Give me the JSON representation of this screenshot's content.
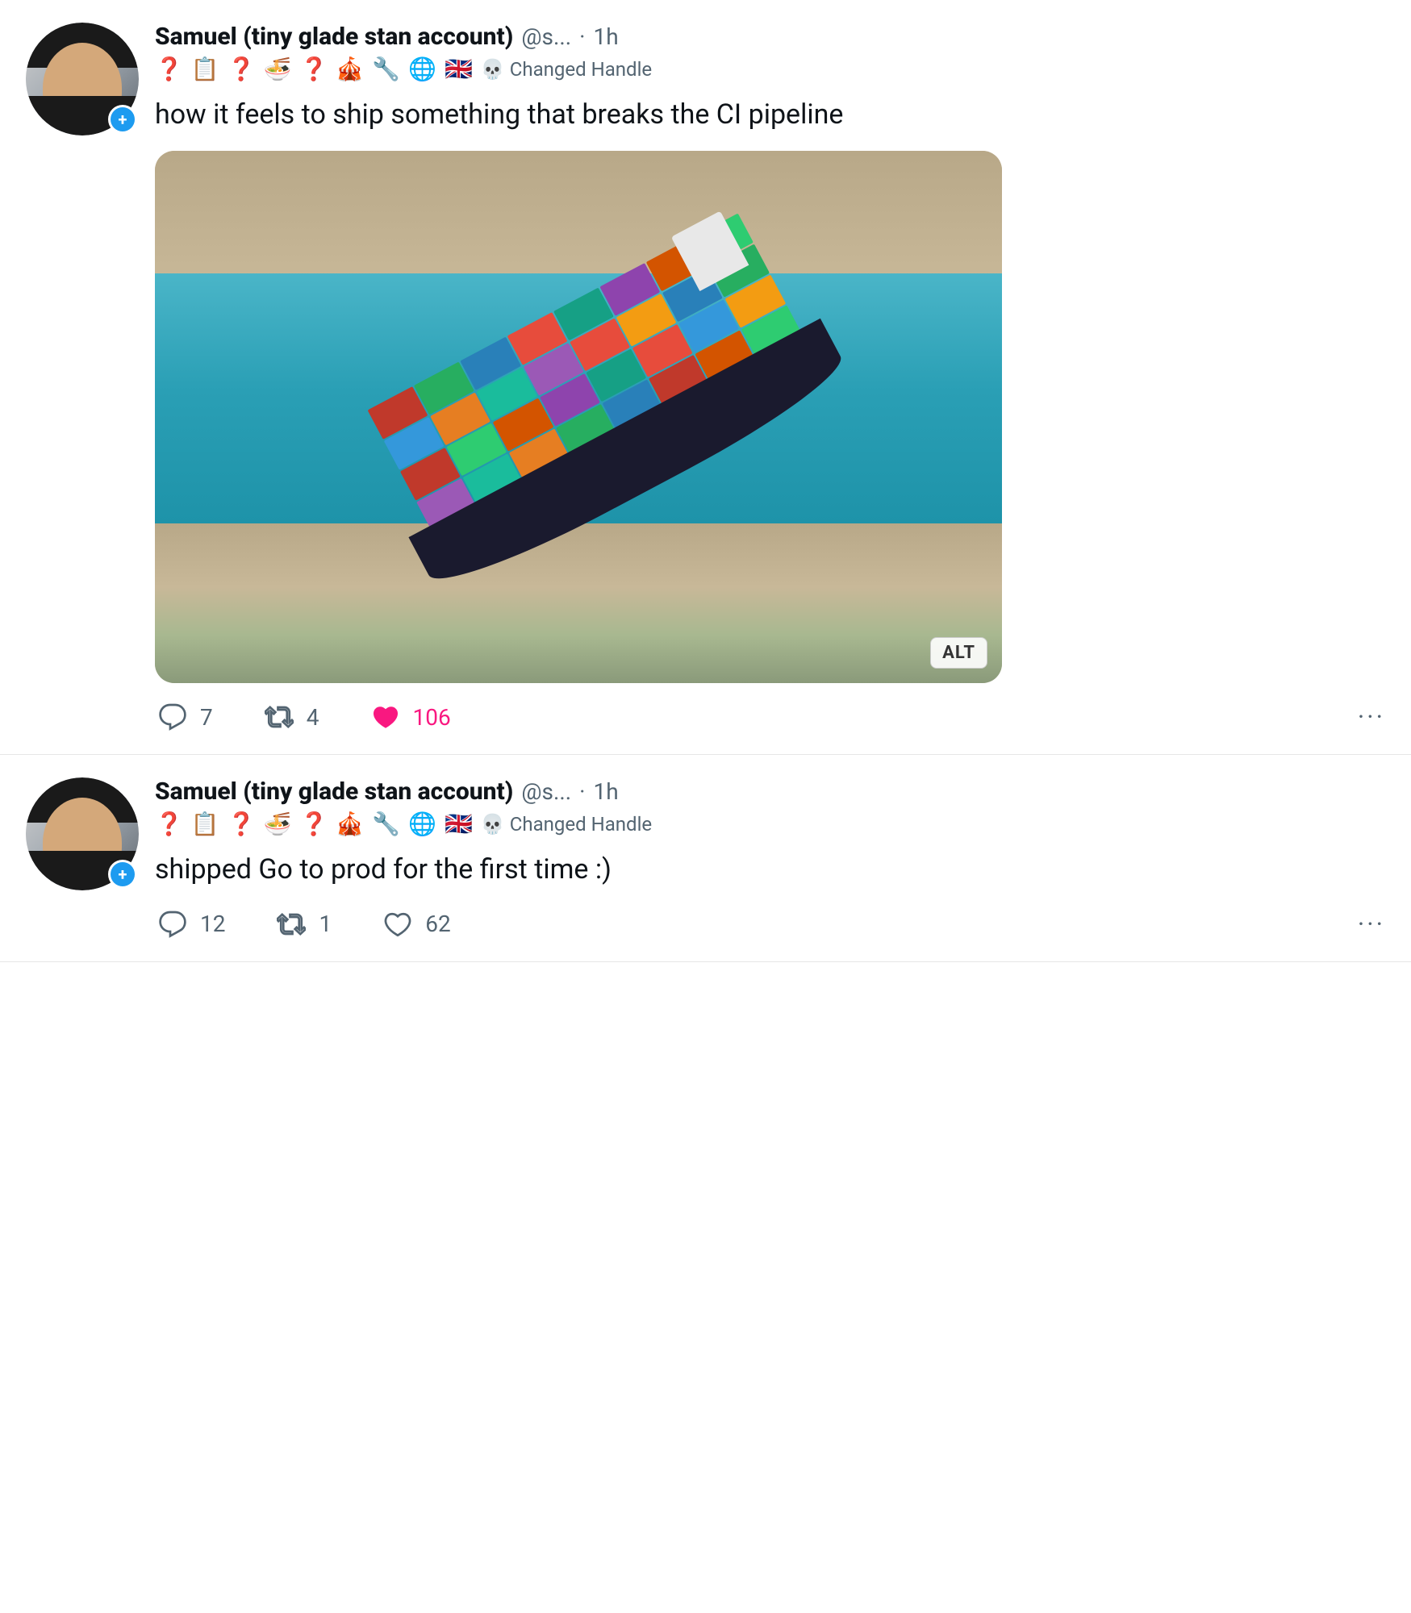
{
  "tweet1": {
    "display_name": "Samuel (tiny glade stan account)",
    "username": "@s...",
    "timestamp": "1h",
    "badges": [
      "❓",
      "📋",
      "❓",
      "🍜",
      "❓",
      "🎪",
      "🔧",
      "🌐",
      "🇬🇧"
    ],
    "changed_handle_skull": "💀",
    "changed_handle_label": "Changed Handle",
    "tweet_text": "how it feels to ship something that breaks the CI pipeline",
    "image_alt": "ALT",
    "reply_count": "7",
    "retweet_count": "4",
    "like_count": "106",
    "liked": true,
    "add_button": "+"
  },
  "tweet2": {
    "display_name": "Samuel (tiny glade stan account)",
    "username": "@s...",
    "timestamp": "1h",
    "badges": [
      "❓",
      "📋",
      "❓",
      "🍜",
      "❓",
      "🎪",
      "🔧",
      "🌐",
      "🇬🇧"
    ],
    "changed_handle_skull": "💀",
    "changed_handle_label": "Changed Handle",
    "tweet_text": "shipped Go to prod for the first time :)",
    "reply_count": "12",
    "retweet_count": "1",
    "like_count": "62",
    "liked": false,
    "add_button": "+"
  }
}
